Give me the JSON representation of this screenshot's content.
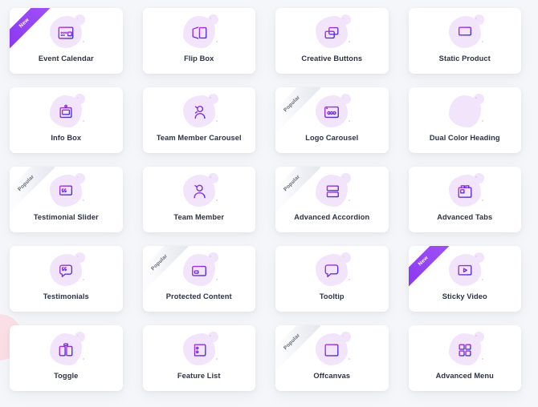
{
  "page": {
    "background_color": "#f5f6f9",
    "card_color": "#ffffff",
    "label_color": "#2d3244",
    "blob_color": "#f2e4fb",
    "ribbon_new_color": "#9340f4",
    "ribbon_popular_color": "#e6e9ef",
    "decor_pink_color": "#fadfe6",
    "icon_gradient_from": "#b431e0",
    "icon_gradient_to": "#3b2fd4"
  },
  "badges": {
    "new_label": "New",
    "popular_label": "Popular"
  },
  "grid": {
    "columns": 4,
    "rows": 5,
    "widgets": [
      {
        "label": "Event Calendar",
        "icon": "calendar-icon",
        "badge": "New"
      },
      {
        "label": "Flip Box",
        "icon": "flip-box-icon",
        "badge": ""
      },
      {
        "label": "Creative Buttons",
        "icon": "creative-buttons-icon",
        "badge": ""
      },
      {
        "label": "Static Product",
        "icon": "static-product-icon",
        "badge": ""
      },
      {
        "label": "Info Box",
        "icon": "info-box-icon",
        "badge": ""
      },
      {
        "label": "Team Member Carousel",
        "icon": "team-member-carousel-icon",
        "badge": ""
      },
      {
        "label": "Logo Carousel",
        "icon": "logo-carousel-icon",
        "badge": "Popular"
      },
      {
        "label": "Dual Color Heading",
        "icon": "dual-color-heading-icon",
        "badge": ""
      },
      {
        "label": "Testimonial Slider",
        "icon": "testimonial-slider-icon",
        "badge": "Popular"
      },
      {
        "label": "Team Member",
        "icon": "team-member-icon",
        "badge": ""
      },
      {
        "label": "Advanced Accordion",
        "icon": "advanced-accordion-icon",
        "badge": "Popular"
      },
      {
        "label": "Advanced Tabs",
        "icon": "advanced-tabs-icon",
        "badge": ""
      },
      {
        "label": "Testimonials",
        "icon": "testimonials-icon",
        "badge": ""
      },
      {
        "label": "Protected Content",
        "icon": "protected-content-icon",
        "badge": "Popular"
      },
      {
        "label": "Tooltip",
        "icon": "tooltip-icon",
        "badge": ""
      },
      {
        "label": "Sticky Video",
        "icon": "sticky-video-icon",
        "badge": "New"
      },
      {
        "label": "Toggle",
        "icon": "toggle-icon",
        "badge": ""
      },
      {
        "label": "Feature List",
        "icon": "feature-list-icon",
        "badge": ""
      },
      {
        "label": "Offcanvas",
        "icon": "offcanvas-icon",
        "badge": "Popular"
      },
      {
        "label": "Advanced Menu",
        "icon": "advanced-menu-icon",
        "badge": ""
      }
    ]
  }
}
